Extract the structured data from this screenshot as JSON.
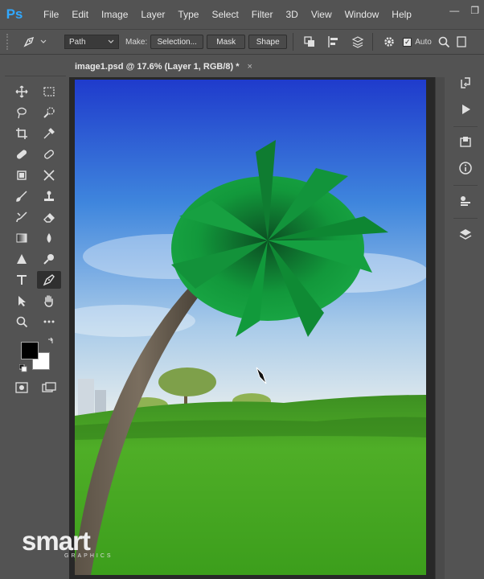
{
  "app": {
    "logo": "Ps"
  },
  "menu": [
    "File",
    "Edit",
    "Image",
    "Layer",
    "Type",
    "Select",
    "Filter",
    "3D",
    "View",
    "Window",
    "Help"
  ],
  "window_controls": [
    "—",
    "❐"
  ],
  "options": {
    "mode_value": "Path",
    "make_label": "Make:",
    "selection_label": "Selection...",
    "mask_label": "Mask",
    "shape_label": "Shape",
    "auto_label": "Auto"
  },
  "document": {
    "tab_title": "image1.psd @ 17.6% (Layer 1, RGB/8) *",
    "close": "×"
  },
  "watermark": {
    "brand": "smart",
    "sub": "GRAPHICS"
  },
  "colors": {
    "foreground": "#000000",
    "background": "#ffffff",
    "ps_blue": "#31a8ff",
    "accent_orange": "#f28a1c"
  }
}
